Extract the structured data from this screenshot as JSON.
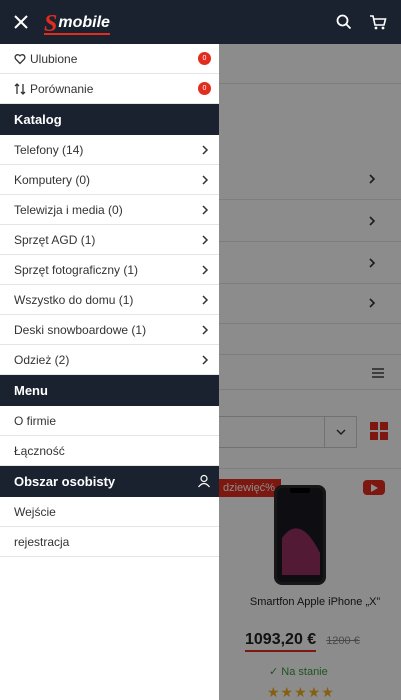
{
  "header": {
    "logo_letter": "S",
    "logo_word": "mobile",
    "colors": {
      "header_bg": "#1a2230",
      "brand_red": "#e22c1d"
    },
    "icons": [
      "close-icon",
      "search-icon",
      "cart-icon"
    ]
  },
  "drawer": {
    "favorites": {
      "label": "Ulubione",
      "count": "0"
    },
    "compare": {
      "label": "Porównanie",
      "count": "0"
    },
    "catalog_heading": "Katalog",
    "catalog_items": [
      "Telefony (14)",
      "Komputery (0)",
      "Telewizja i media (0)",
      "Sprzęt AGD (1)",
      "Sprzęt fotograficzny (1)",
      "Wszystko do domu (1)",
      "Deski snowboardowe (1)",
      "Odzież (2)"
    ],
    "menu_heading": "Menu",
    "menu_items": [
      "O firmie",
      "Łączność"
    ],
    "account_heading": "Obszar osobisty",
    "account_items": [
      "Wejście",
      "rejestracja"
    ]
  },
  "background": {
    "discount_label": "dziewięć%",
    "product_name": "Smartfon Apple iPhone „X”",
    "price_now": "1093,20 €",
    "price_old": "1200 €",
    "stock": "✓ Na stanie",
    "rating_stars": "★★★★★"
  }
}
